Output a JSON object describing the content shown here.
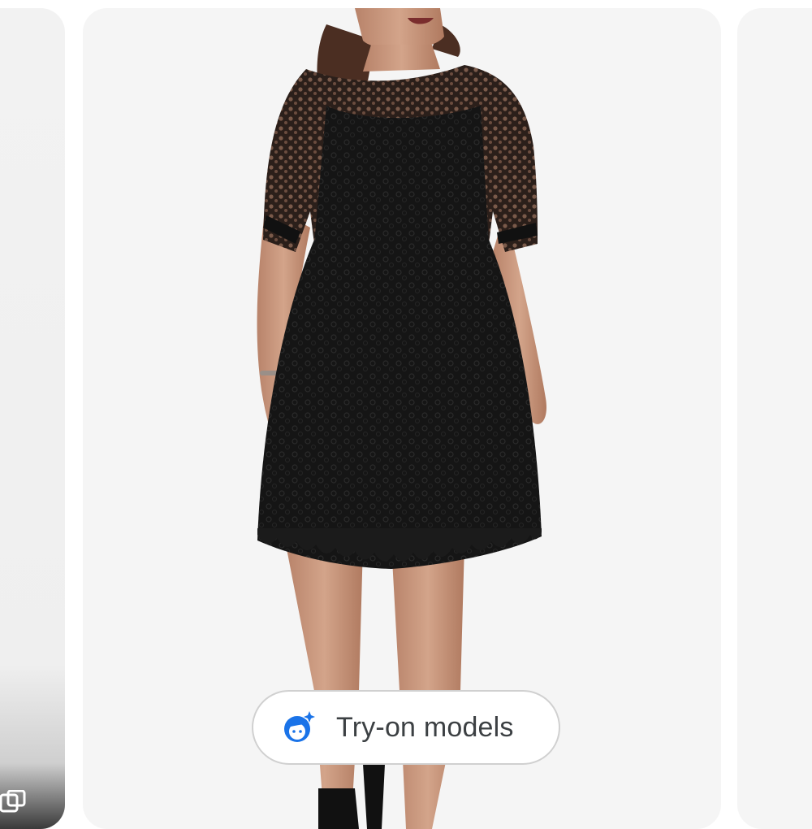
{
  "tryon": {
    "label": "Try-on models",
    "icon": "face-sparkle-icon",
    "icon_color": "#1a73e8"
  },
  "colors": {
    "card_background": "#f5f5f5",
    "button_border": "#d0d0d0",
    "label_text": "#3c4043"
  }
}
